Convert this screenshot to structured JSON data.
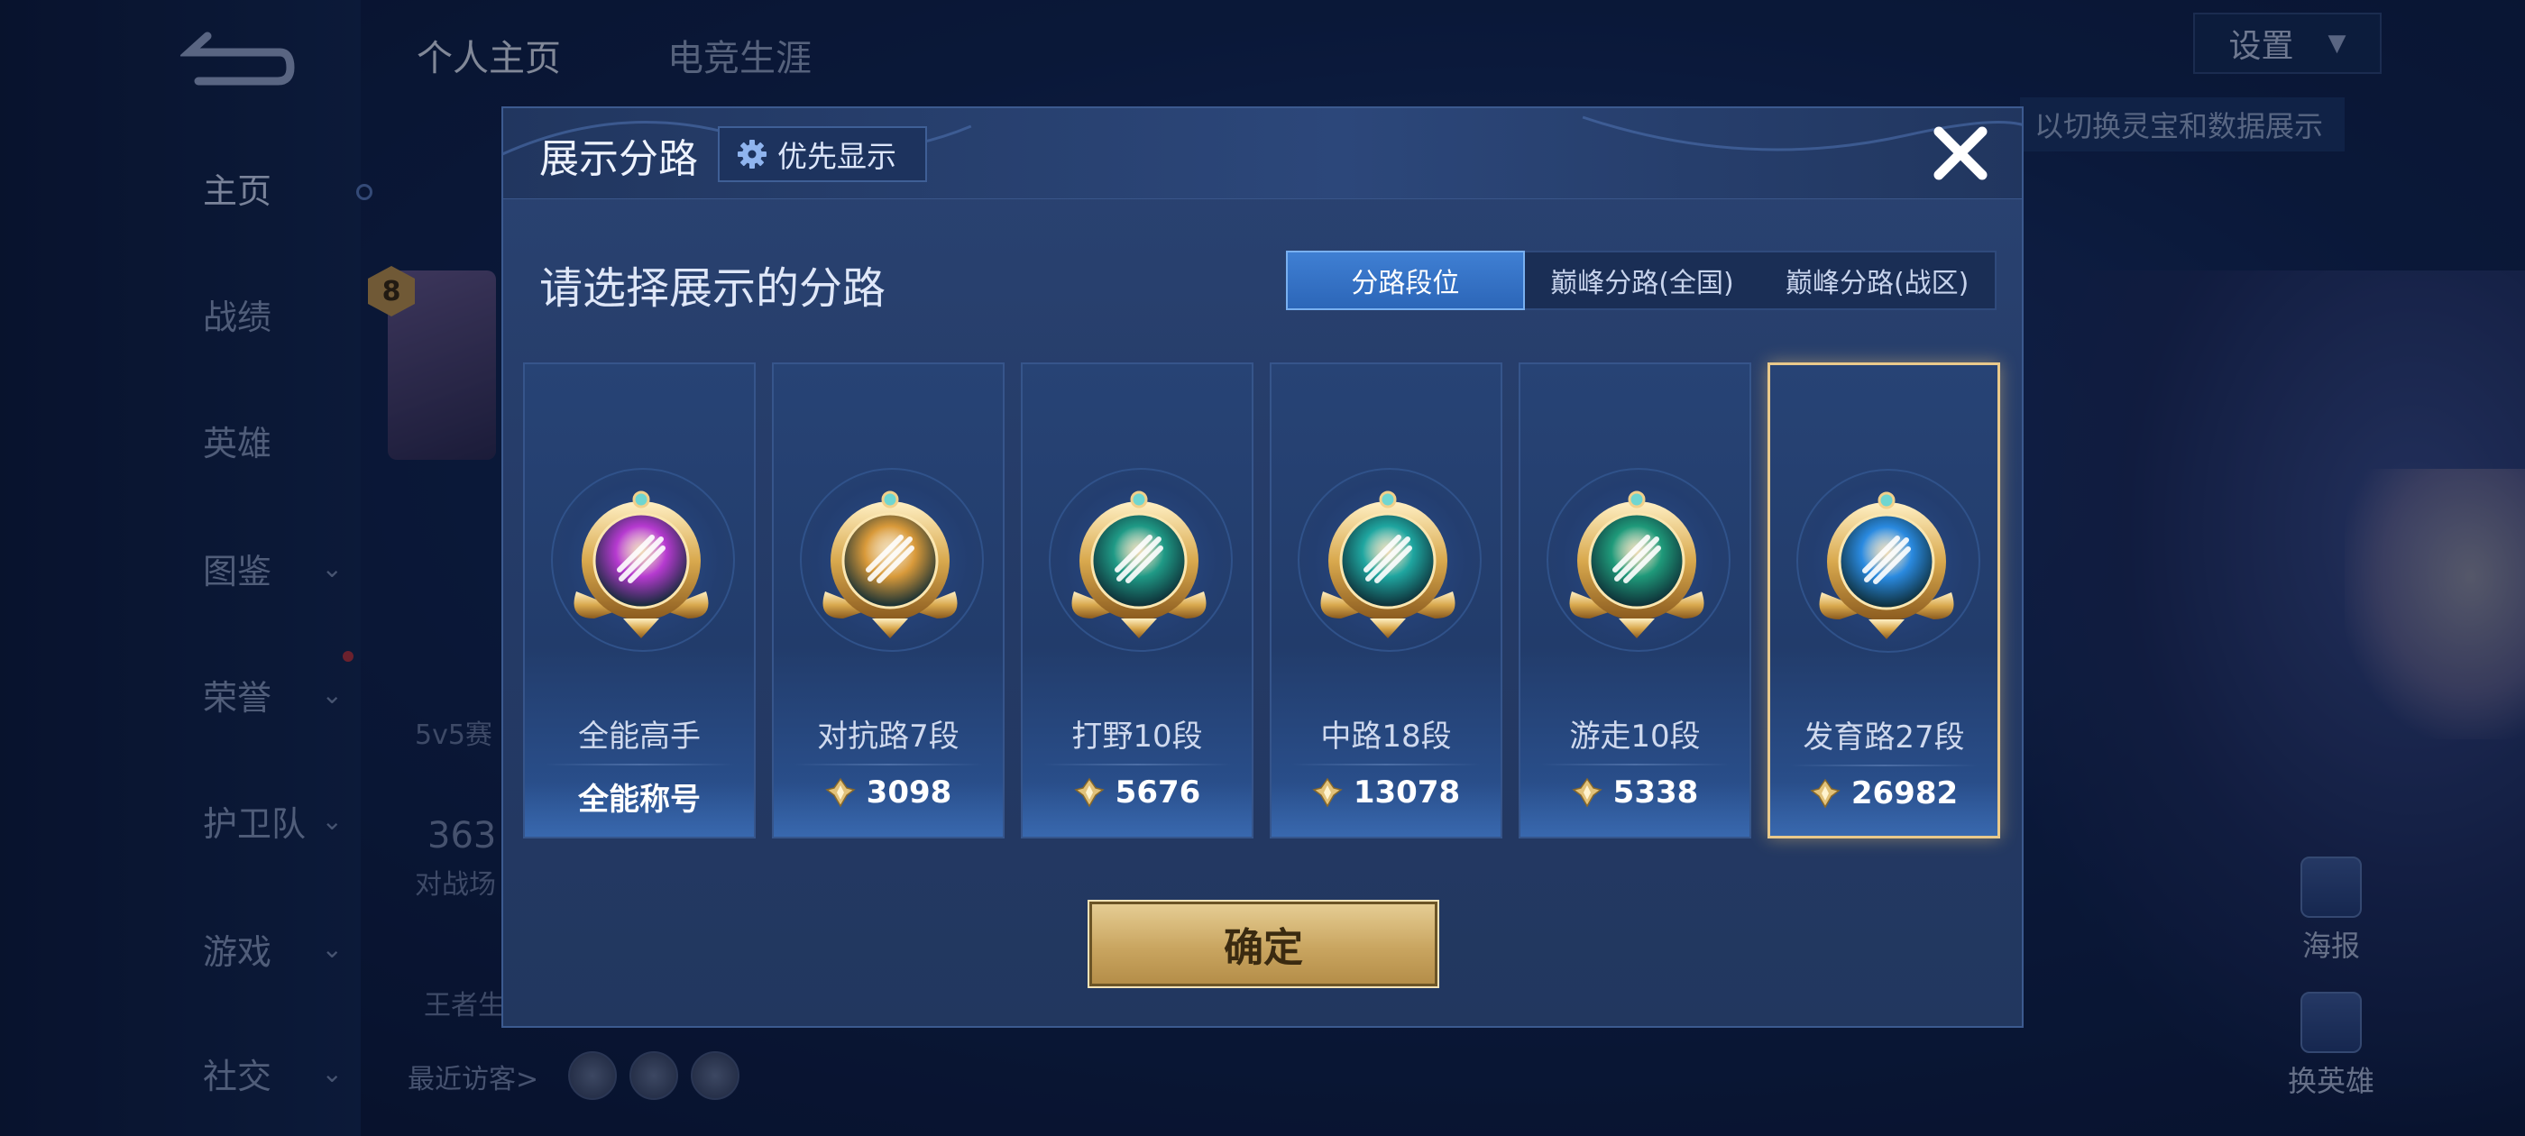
{
  "background": {
    "sidebar": [
      {
        "label": "主页",
        "has_chevron": false,
        "active": true
      },
      {
        "label": "战绩",
        "has_chevron": false
      },
      {
        "label": "英雄",
        "has_chevron": false
      },
      {
        "label": "图鉴",
        "has_chevron": true
      },
      {
        "label": "荣誉",
        "has_chevron": true
      },
      {
        "label": "护卫队",
        "has_chevron": true
      },
      {
        "label": "游戏",
        "has_chevron": true
      },
      {
        "label": "社交",
        "has_chevron": true
      }
    ],
    "top_tabs": [
      "个人主页",
      "电竞生涯"
    ],
    "settings_label": "设置",
    "tip_text": "以切换灵宝和数据展示",
    "badge_level": "8",
    "mode_text": "5v5赛",
    "match_count": "363",
    "match_label": "对战场",
    "king_label": "王者生",
    "recent_visitors": "最近访客>",
    "right_actions": [
      "海报",
      "换英雄"
    ]
  },
  "modal": {
    "title": "展示分路",
    "priority_label": "优先显示",
    "section_title": "请选择展示的分路",
    "tabs": [
      {
        "label": "分路段位",
        "active": true
      },
      {
        "label": "巅峰分路(全国)",
        "active": false
      },
      {
        "label": "巅峰分路(战区)",
        "active": false
      }
    ],
    "cards": [
      {
        "name": "全能高手",
        "value": "全能称号",
        "icon": "all-round-medal-icon",
        "color": "#b63ad0",
        "has_points": false,
        "selected": false
      },
      {
        "name": "对抗路7段",
        "value": "3098",
        "icon": "clash-lane-medal-icon",
        "color": "#d99a3a",
        "has_points": true,
        "selected": false
      },
      {
        "name": "打野10段",
        "value": "5676",
        "icon": "jungle-medal-icon",
        "color": "#1f9a86",
        "has_points": true,
        "selected": false
      },
      {
        "name": "中路18段",
        "value": "13078",
        "icon": "mid-lane-medal-icon",
        "color": "#1fa6a0",
        "has_points": true,
        "selected": false
      },
      {
        "name": "游走10段",
        "value": "5338",
        "icon": "roam-medal-icon",
        "color": "#1f9a7a",
        "has_points": true,
        "selected": false
      },
      {
        "name": "发育路27段",
        "value": "26982",
        "icon": "farm-lane-medal-icon",
        "color": "#2a8ae0",
        "has_points": true,
        "selected": true
      }
    ],
    "confirm_label": "确定"
  }
}
